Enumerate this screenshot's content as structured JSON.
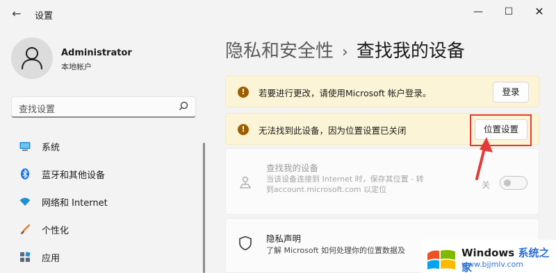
{
  "window": {
    "title": "设置",
    "back_icon": "back-arrow-icon",
    "minimize_icon": "minimize-icon",
    "maximize_icon": "maximize-icon",
    "close_icon": "close-icon"
  },
  "user": {
    "name": "Administrator",
    "account_type": "本地帐户"
  },
  "search": {
    "text": "查找设置",
    "icon": "search-icon"
  },
  "nav": {
    "items": [
      {
        "label": "系统",
        "icon": "monitor-icon"
      },
      {
        "label": "蓝牙和其他设备",
        "icon": "bluetooth-icon"
      },
      {
        "label": "网络和 Internet",
        "icon": "wifi-icon"
      },
      {
        "label": "个性化",
        "icon": "brush-icon"
      },
      {
        "label": "应用",
        "icon": "apps-icon"
      }
    ]
  },
  "breadcrumb": {
    "parent": "隐私和安全性",
    "separator": "›",
    "current": "查找我的设备"
  },
  "banners": [
    {
      "text": "若要进行更改，请使用Microsoft 帐户登录。",
      "button": "登录",
      "icon": "warning-icon"
    },
    {
      "text": "无法找到此设备，因为位置设置已关闭",
      "button": "位置设置",
      "icon": "warning-icon"
    }
  ],
  "find_device": {
    "title": "查找我的设备",
    "description": "当该设备连接到 Internet 时，保存其位置 - 转到account.microsoft.com 以定位",
    "toggle_label": "关",
    "toggle_on": false,
    "icon": "location-pin-icon"
  },
  "privacy": {
    "title": "隐私声明",
    "description": "了解 Microsoft 如何处理你的位置数据及",
    "icon": "shield-icon"
  },
  "watermark": {
    "brand": "Windows",
    "suffix": "系统之家",
    "url": "www.bjjmlv.com"
  },
  "colors": {
    "accent": "#0067c0",
    "warning_bg": "#fcf4d6",
    "warning_icon": "#9d5d00",
    "highlight": "#e53935"
  }
}
